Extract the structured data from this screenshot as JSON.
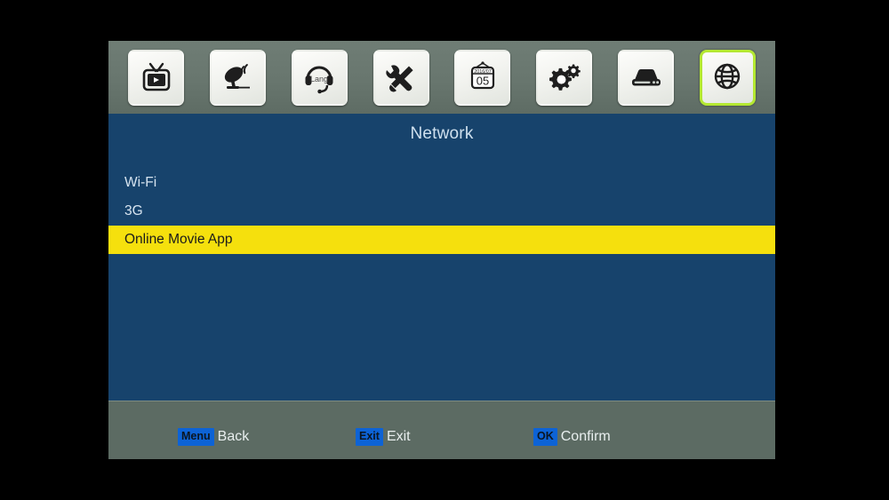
{
  "iconbar": {
    "items": [
      {
        "name": "tv-icon",
        "label": "TV"
      },
      {
        "name": "satellite-icon",
        "label": "Installation"
      },
      {
        "name": "headset-lang-icon",
        "label": "Lang",
        "glyph_text": "Lang"
      },
      {
        "name": "tools-icon",
        "label": "Tools"
      },
      {
        "name": "calendar-icon",
        "label": "Timer",
        "date_top": "2016/07",
        "date_day": "05"
      },
      {
        "name": "gears-icon",
        "label": "System Setup"
      },
      {
        "name": "harddrive-icon",
        "label": "Media"
      },
      {
        "name": "globe-icon",
        "label": "Network",
        "selected": true
      }
    ],
    "selection_color": "#b4e832"
  },
  "menu": {
    "title": "Network",
    "items": [
      {
        "label": "Wi-Fi",
        "highlighted": false
      },
      {
        "label": "3G",
        "highlighted": false
      },
      {
        "label": "Online Movie App",
        "highlighted": true
      }
    ],
    "highlight_color": "#f5e00d",
    "panel_color": "#17436c"
  },
  "footer": {
    "hints": [
      {
        "key": "Menu",
        "label": "Back"
      },
      {
        "key": "Exit",
        "label": "Exit"
      },
      {
        "key": "OK",
        "label": "Confirm"
      }
    ],
    "key_badge_color": "#0d63d6",
    "bar_color": "#5c6b63"
  }
}
